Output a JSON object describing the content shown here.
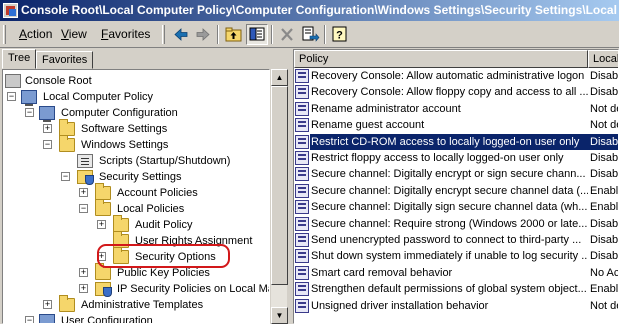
{
  "window": {
    "title": "Console Root\\Local Computer Policy\\Computer Configuration\\Windows Settings\\Security Settings\\Local Polic"
  },
  "menu": {
    "action": {
      "accel": "A",
      "rest": "ction"
    },
    "view": {
      "accel": "V",
      "rest": "iew"
    },
    "favorites": {
      "accel": "F",
      "rest": "avorites"
    }
  },
  "toolbar": {
    "buttons": [
      "back-arrow-icon",
      "forward-arrow-icon",
      "up-folder-icon",
      "show-hide-tree-icon",
      "delete-icon",
      "export-list-icon",
      "help-icon"
    ]
  },
  "tabs": [
    {
      "label": "Tree",
      "active": true
    },
    {
      "label": "Favorites",
      "active": false
    }
  ],
  "tree": {
    "items": [
      {
        "label": "Console Root"
      },
      {
        "label": "Local Computer Policy"
      },
      {
        "label": "Computer Configuration"
      },
      {
        "label": "Software Settings"
      },
      {
        "label": "Windows Settings"
      },
      {
        "label": "Scripts (Startup/Shutdown)"
      },
      {
        "label": "Security Settings"
      },
      {
        "label": "Account Policies"
      },
      {
        "label": "Local Policies"
      },
      {
        "label": "Audit Policy"
      },
      {
        "label": "User Rights Assignment"
      },
      {
        "label": "Security Options"
      },
      {
        "label": "Public Key Policies"
      },
      {
        "label": "IP Security Policies on Local Mac"
      },
      {
        "label": "Administrative Templates"
      },
      {
        "label": "User Configuration"
      }
    ]
  },
  "list": {
    "columns": {
      "policy": "Policy",
      "setting": "Local S"
    },
    "rows": [
      {
        "policy": "Recovery Console: Allow automatic administrative logon",
        "setting": "Disab"
      },
      {
        "policy": "Recovery Console: Allow floppy copy and access to all ...",
        "setting": "Disab"
      },
      {
        "policy": "Rename administrator account",
        "setting": "Not de"
      },
      {
        "policy": "Rename guest account",
        "setting": "Not de"
      },
      {
        "policy": "Restrict CD-ROM access to locally logged-on user only",
        "setting": "Disab",
        "selected": true
      },
      {
        "policy": "Restrict floppy access to locally logged-on user only",
        "setting": "Disab"
      },
      {
        "policy": "Secure channel: Digitally encrypt or sign secure chann...",
        "setting": "Disab"
      },
      {
        "policy": "Secure channel: Digitally encrypt secure channel data (...",
        "setting": "Enable"
      },
      {
        "policy": "Secure channel: Digitally sign secure channel data (wh...",
        "setting": "Enable"
      },
      {
        "policy": "Secure channel: Require strong (Windows 2000 or late...",
        "setting": "Disab"
      },
      {
        "policy": "Send unencrypted password to connect to third-party ...",
        "setting": "Disab"
      },
      {
        "policy": "Shut down system immediately if unable to log security ...",
        "setting": "Disab"
      },
      {
        "policy": "Smart card removal behavior",
        "setting": "No Ac"
      },
      {
        "policy": "Strengthen default permissions of global system object...",
        "setting": "Enable"
      },
      {
        "policy": "Unsigned driver installation behavior",
        "setting": "Not de"
      }
    ]
  },
  "colors": {
    "title_gradient_start": "#0a246a",
    "title_gradient_end": "#a6caf0",
    "selection": "#0a246a",
    "highlight_ring": "#d2181a"
  }
}
